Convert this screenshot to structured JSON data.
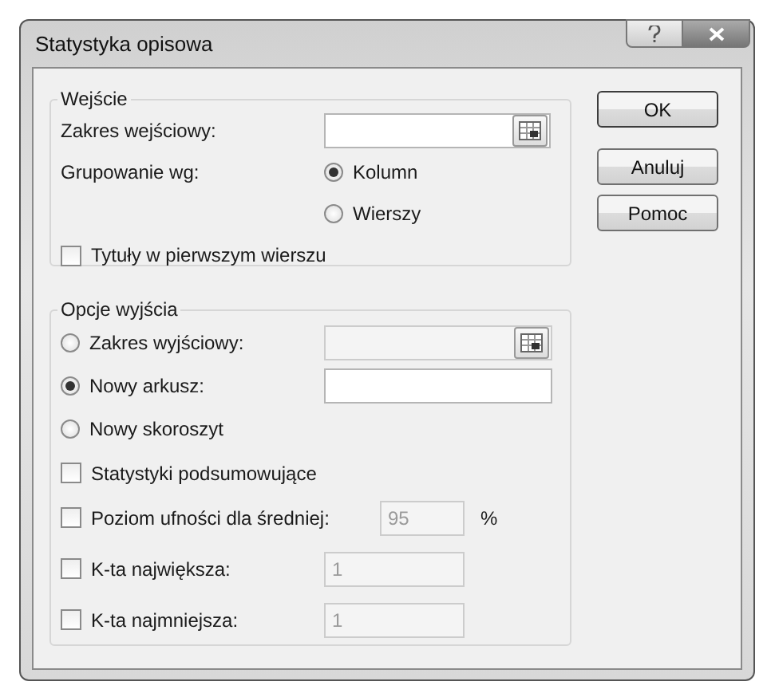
{
  "window": {
    "title": "Statystyka opisowa"
  },
  "input_group": {
    "legend": "Wejście",
    "range": {
      "label": "Zakres wejściowy:",
      "disabled": false
    },
    "grouping": {
      "label": "Grupowanie wg:",
      "options": [
        {
          "label": "Kolumn",
          "selected": true
        },
        {
          "label": "Wierszy",
          "selected": false
        }
      ]
    },
    "headers": {
      "label": "Tytuły w pierwszym wierszu",
      "checked": false
    }
  },
  "output_group": {
    "legend": "Opcje wyjścia",
    "items": [
      {
        "kind": "radio-range",
        "label": "Zakres wyjściowy:",
        "selected": false,
        "disabled": true
      },
      {
        "kind": "radio-field",
        "label": "Nowy arkusz:",
        "selected": true,
        "disabled": false
      },
      {
        "kind": "radio",
        "label": "Nowy skoroszyt",
        "selected": false
      },
      {
        "kind": "check",
        "label": "Statystyki podsumowujące",
        "checked": false
      },
      {
        "kind": "check-field",
        "label": "Poziom ufności dla średniej:",
        "checked": false,
        "value": "95",
        "unit": "%",
        "disabled": true
      },
      {
        "kind": "check-field",
        "label": "K-ta największa:",
        "checked": false,
        "value": "1",
        "disabled": true
      },
      {
        "kind": "check-field",
        "label": "K-ta najmniejsza:",
        "checked": false,
        "value": "1",
        "disabled": true
      }
    ]
  },
  "buttons": [
    {
      "label": "OK"
    },
    {
      "label": "Anuluj"
    },
    {
      "label": "Pomoc"
    }
  ]
}
